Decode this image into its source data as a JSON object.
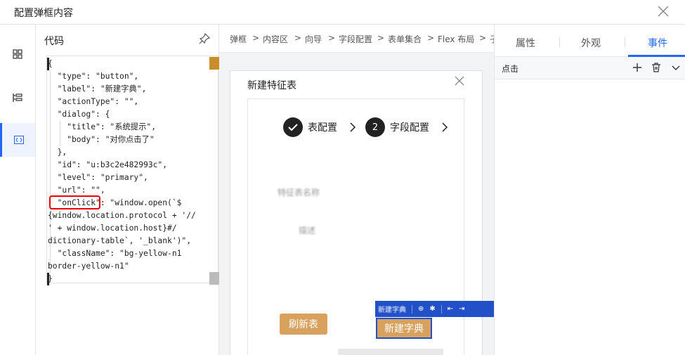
{
  "window": {
    "title": "配置弹框内容"
  },
  "code_panel": {
    "title": "代码",
    "lines": [
      "{",
      "  \"type\": \"button\",",
      "  \"label\": \"新建字典\",",
      "  \"actionType\": \"\",",
      "  \"dialog\": {",
      "    \"title\": \"系统提示\",",
      "    \"body\": \"对你点击了\"",
      "  },",
      "  \"id\": \"u:b3c2e482993c\",",
      "  \"level\": \"primary\",",
      "  \"url\": \"\",",
      "  \"onClick\": \"window.open(`$",
      "{window.location.protocol + '//",
      "' + window.location.host}#/",
      "dictionary-table`, '_blank')\",",
      "  \"className\": \"bg-yellow-n1",
      "border-yellow-n1\"",
      "}"
    ]
  },
  "breadcrumb": [
    "弹框",
    "内容区",
    "向导",
    "字段配置",
    "表单集合",
    "Flex 布局",
    "子"
  ],
  "breadcrumb_sep": ">",
  "preview": {
    "dialog_title": "新建特征表",
    "steps": [
      {
        "num": "✓",
        "label": "表配置"
      },
      {
        "num": "2",
        "label": "字段配置"
      }
    ],
    "blurred_1": "特征表名称",
    "blurred_2": "描述",
    "refresh_button": "刷新表",
    "new_dict_button": "新建字典",
    "toolbar_label": "新建字典"
  },
  "props": {
    "tabs": [
      "属性",
      "外观",
      "事件"
    ],
    "active_tab": "事件",
    "event_label": "点击"
  },
  "colors": {
    "accent": "#2468f2",
    "button": "#d9a15e",
    "toolbar": "#2150c8",
    "highlight": "#e00000"
  }
}
